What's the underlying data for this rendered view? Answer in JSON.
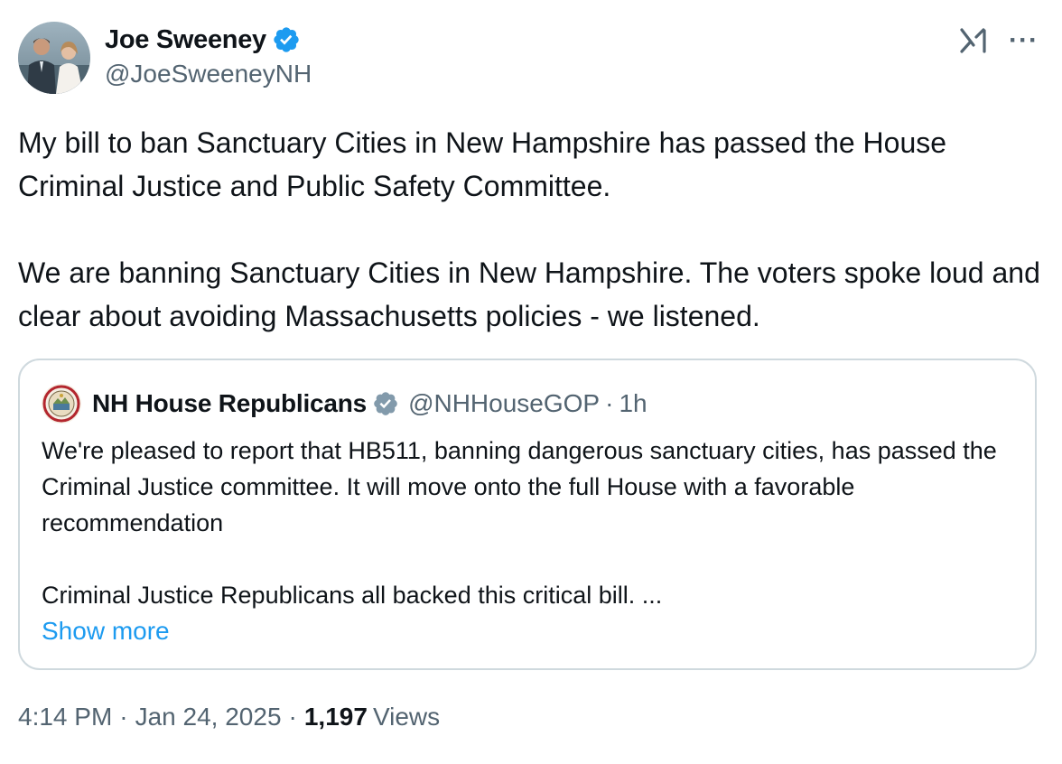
{
  "author": {
    "display_name": "Joe Sweeney",
    "handle": "@JoeSweeneyNH",
    "verified": true,
    "verified_color": "#1d9bf0"
  },
  "tweet": {
    "paragraphs": [
      "My bill to ban Sanctuary Cities in New Hampshire has passed the House Criminal Justice and Public Safety Committee.",
      "We are banning Sanctuary Cities in New Hampshire. The voters spoke loud and clear about avoiding Massachusetts policies - we listened."
    ]
  },
  "quoted_tweet": {
    "display_name": "NH House Republicans",
    "handle": "@NHHouseGOP",
    "separator": "·",
    "time": "1h",
    "verified": true,
    "verified_color": "#829aab",
    "paragraphs": [
      "We're pleased to report that HB511, banning dangerous sanctuary cities, has passed the Criminal Justice committee. It will move onto the full House with a favorable recommendation",
      "Criminal Justice Republicans all backed this critical bill. ..."
    ],
    "show_more": "Show more"
  },
  "meta": {
    "time": "4:14 PM",
    "separator": "·",
    "date": "Jan 24, 2025",
    "views_count": "1,197",
    "views_label": "Views"
  },
  "icons": {
    "grok": "grok-icon",
    "more": "more-options-icon",
    "more_glyph": "···"
  },
  "colors": {
    "text": "#0f1419",
    "secondary": "#536471",
    "link": "#1d9bf0",
    "border": "#cfd9de"
  }
}
